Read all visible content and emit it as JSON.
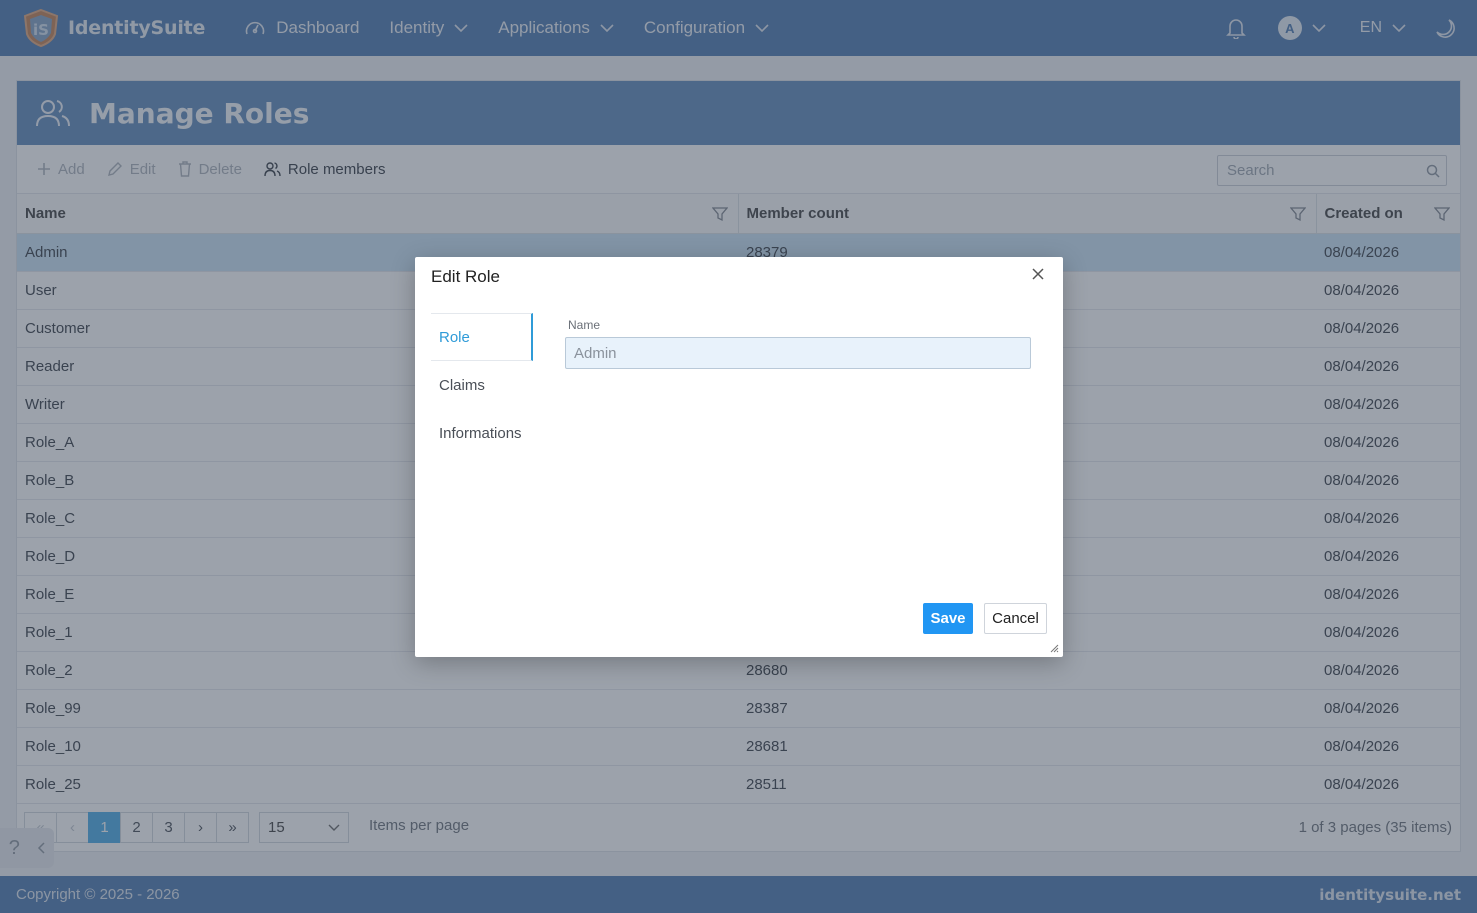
{
  "brand": {
    "name": "IdentitySuite"
  },
  "nav": {
    "dashboard": "Dashboard",
    "identity": "Identity",
    "applications": "Applications",
    "configuration": "Configuration"
  },
  "user": {
    "avatar_letter": "A",
    "language": "EN"
  },
  "page": {
    "title": "Manage Roles"
  },
  "toolbar": {
    "add": "Add",
    "edit": "Edit",
    "delete": "Delete",
    "role_members": "Role members",
    "search_placeholder": "Search"
  },
  "table": {
    "columns": [
      "Name",
      "Member count",
      "Created on"
    ],
    "rows": [
      {
        "name": "Admin",
        "members": "28379",
        "created": "08/04/2026",
        "selected": true
      },
      {
        "name": "User",
        "members": "",
        "created": "08/04/2026"
      },
      {
        "name": "Customer",
        "members": "",
        "created": "08/04/2026"
      },
      {
        "name": "Reader",
        "members": "",
        "created": "08/04/2026"
      },
      {
        "name": "Writer",
        "members": "",
        "created": "08/04/2026"
      },
      {
        "name": "Role_A",
        "members": "",
        "created": "08/04/2026"
      },
      {
        "name": "Role_B",
        "members": "",
        "created": "08/04/2026"
      },
      {
        "name": "Role_C",
        "members": "",
        "created": "08/04/2026"
      },
      {
        "name": "Role_D",
        "members": "",
        "created": "08/04/2026"
      },
      {
        "name": "Role_E",
        "members": "",
        "created": "08/04/2026"
      },
      {
        "name": "Role_1",
        "members": "",
        "created": "08/04/2026"
      },
      {
        "name": "Role_2",
        "members": "28680",
        "created": "08/04/2026"
      },
      {
        "name": "Role_99",
        "members": "28387",
        "created": "08/04/2026"
      },
      {
        "name": "Role_10",
        "members": "28681",
        "created": "08/04/2026"
      },
      {
        "name": "Role_25",
        "members": "28511",
        "created": "08/04/2026"
      }
    ]
  },
  "pager": {
    "pages": [
      "1",
      "2",
      "3"
    ],
    "current": "1",
    "items_per_page_value": "15",
    "items_per_page_label": "Items per page",
    "info": "1 of 3 pages (35 items)"
  },
  "footer": {
    "copyright": "Copyright © 2025 - 2026",
    "site": "identitysuite.net"
  },
  "help": {
    "label": "?"
  },
  "modal": {
    "title": "Edit Role",
    "tabs": [
      "Role",
      "Claims",
      "Informations"
    ],
    "active_tab": "Role",
    "name_label": "Name",
    "name_value": "Admin",
    "save": "Save",
    "cancel": "Cancel"
  },
  "colors": {
    "header": "#5f87b8",
    "accent": "#2196f3",
    "selected_row": "#cfe6f6"
  }
}
